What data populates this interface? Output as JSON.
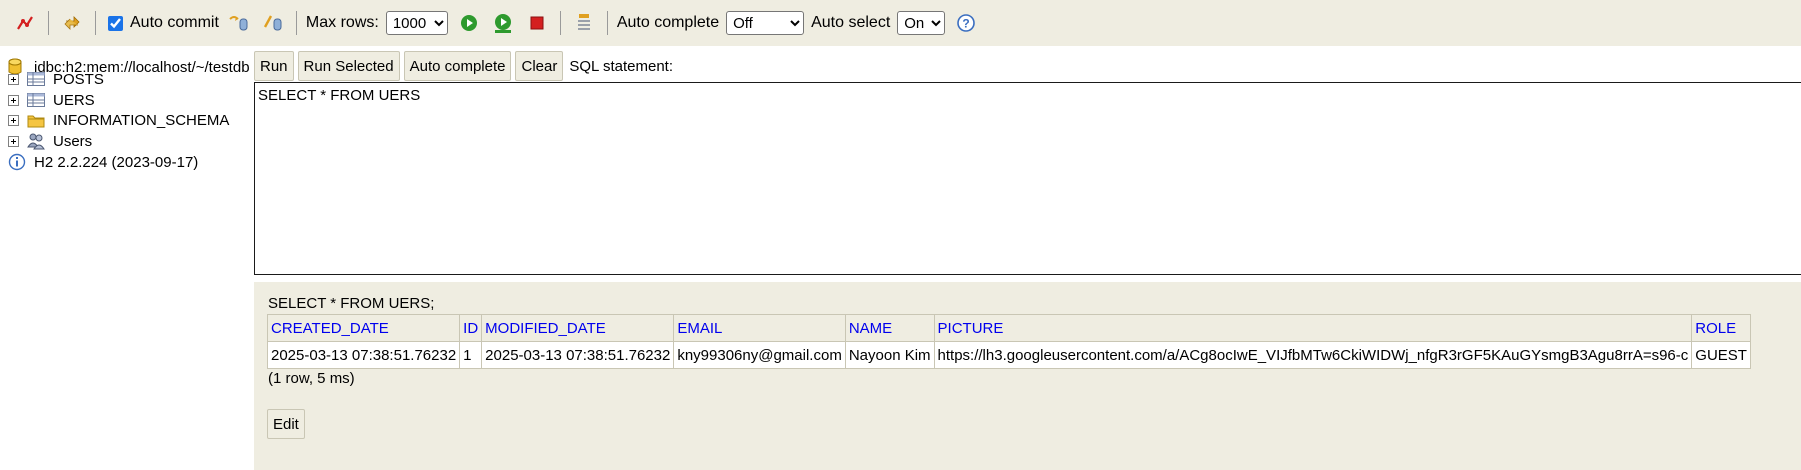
{
  "toolbar": {
    "auto_commit_label": "Auto commit",
    "auto_commit_checked": true,
    "max_rows_label": "Max rows:",
    "max_rows_value": "1000",
    "auto_complete_label": "Auto complete",
    "auto_complete_value": "Off",
    "auto_select_label": "Auto select",
    "auto_select_value": "On",
    "help_symbol": "?"
  },
  "tree": {
    "connection": "jdbc:h2:mem://localhost/~/testdb",
    "items": [
      {
        "label": "POSTS",
        "icon": "table-icon"
      },
      {
        "label": "UERS",
        "icon": "table-icon"
      },
      {
        "label": "INFORMATION_SCHEMA",
        "icon": "folder-icon"
      },
      {
        "label": "Users",
        "icon": "users-icon"
      }
    ],
    "version": "H2 2.2.224 (2023-09-17)"
  },
  "query": {
    "run_label": "Run",
    "run_selected_label": "Run Selected",
    "auto_complete_label": "Auto complete",
    "clear_label": "Clear",
    "sql_statement_label": "SQL statement:",
    "sql_text": "SELECT * FROM UERS"
  },
  "results": {
    "statement": "SELECT * FROM UERS;",
    "columns": [
      "CREATED_DATE",
      "ID",
      "MODIFIED_DATE",
      "EMAIL",
      "NAME",
      "PICTURE",
      "ROLE"
    ],
    "rows": [
      [
        "2025-03-13 07:38:51.76232",
        "1",
        "2025-03-13 07:38:51.76232",
        "kny99306ny@gmail.com",
        "Nayoon Kim",
        "https://lh3.googleusercontent.com/a/ACg8ocIwE_VIJfbMTw6CkiWIDWj_nfgR3rGF5KAuGYsmgB3Agu8rrA=s96-c",
        "GUEST"
      ]
    ],
    "count_text": "(1 row, 5 ms)",
    "edit_label": "Edit"
  },
  "colors": {
    "toolbar_bg": "#efede1",
    "header_link": "#0000ee",
    "run_green": "#2e9a2e",
    "stop_red": "#d42020"
  }
}
